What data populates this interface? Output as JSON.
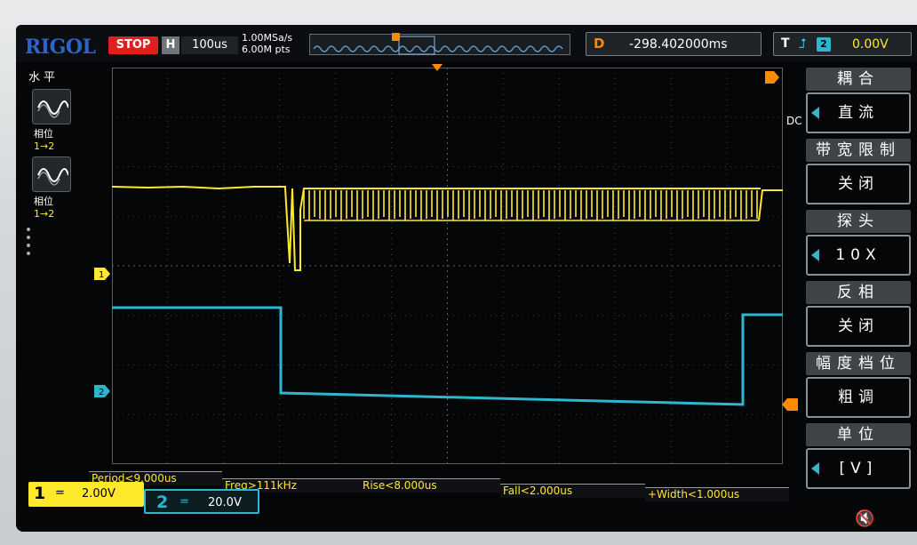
{
  "header": {
    "logo": "RIGOL",
    "run_state": "STOP",
    "horizontal_label": "H",
    "timebase": "100us",
    "sample_rate": "1.00MSa/s",
    "memory_depth": "6.00M pts",
    "delay_label": "D",
    "delay_value": "-298.402000ms",
    "trigger_label": "T",
    "trigger_edge_icon": "rising-edge-icon",
    "trigger_source": "2",
    "trigger_level": "0.00V"
  },
  "left_panel": {
    "title": "水平",
    "buttons": [
      {
        "label": "相位",
        "sub": "1→2",
        "icon": "phase-wave-icon"
      },
      {
        "label": "相位",
        "sub": "1→2",
        "icon": "phase-wave-icon"
      }
    ]
  },
  "right_menu": {
    "side_text": "DC",
    "items": [
      {
        "title": "耦合",
        "value": "直流",
        "has_arrow": true
      },
      {
        "title": "带宽限制",
        "value": "关闭",
        "has_arrow": false
      },
      {
        "title": "探头",
        "value": "10X",
        "has_arrow": true
      },
      {
        "title": "反相",
        "value": "关闭",
        "has_arrow": false
      },
      {
        "title": "幅度档位",
        "value": "粗调",
        "has_arrow": false
      },
      {
        "title": "单位",
        "value": "[V]",
        "has_arrow": true
      }
    ]
  },
  "measurements": [
    "Period<9.000us",
    "Freq>111kHz",
    "Rise<8.000us",
    "Fall<2.000us",
    "+Width<1.000us"
  ],
  "channels": [
    {
      "number": "1",
      "coupling": "=",
      "scale": "2.00V",
      "color": "#ffe92a"
    },
    {
      "number": "2",
      "coupling": "=",
      "scale": "20.0V",
      "color": "#2fb6cf"
    }
  ],
  "colors": {
    "ch1": "#ffe92a",
    "ch2": "#2fb6cf",
    "trigger": "#ff8a00",
    "grid": "#4a4f52"
  },
  "icons": {
    "speaker": "speaker-mute-icon"
  }
}
